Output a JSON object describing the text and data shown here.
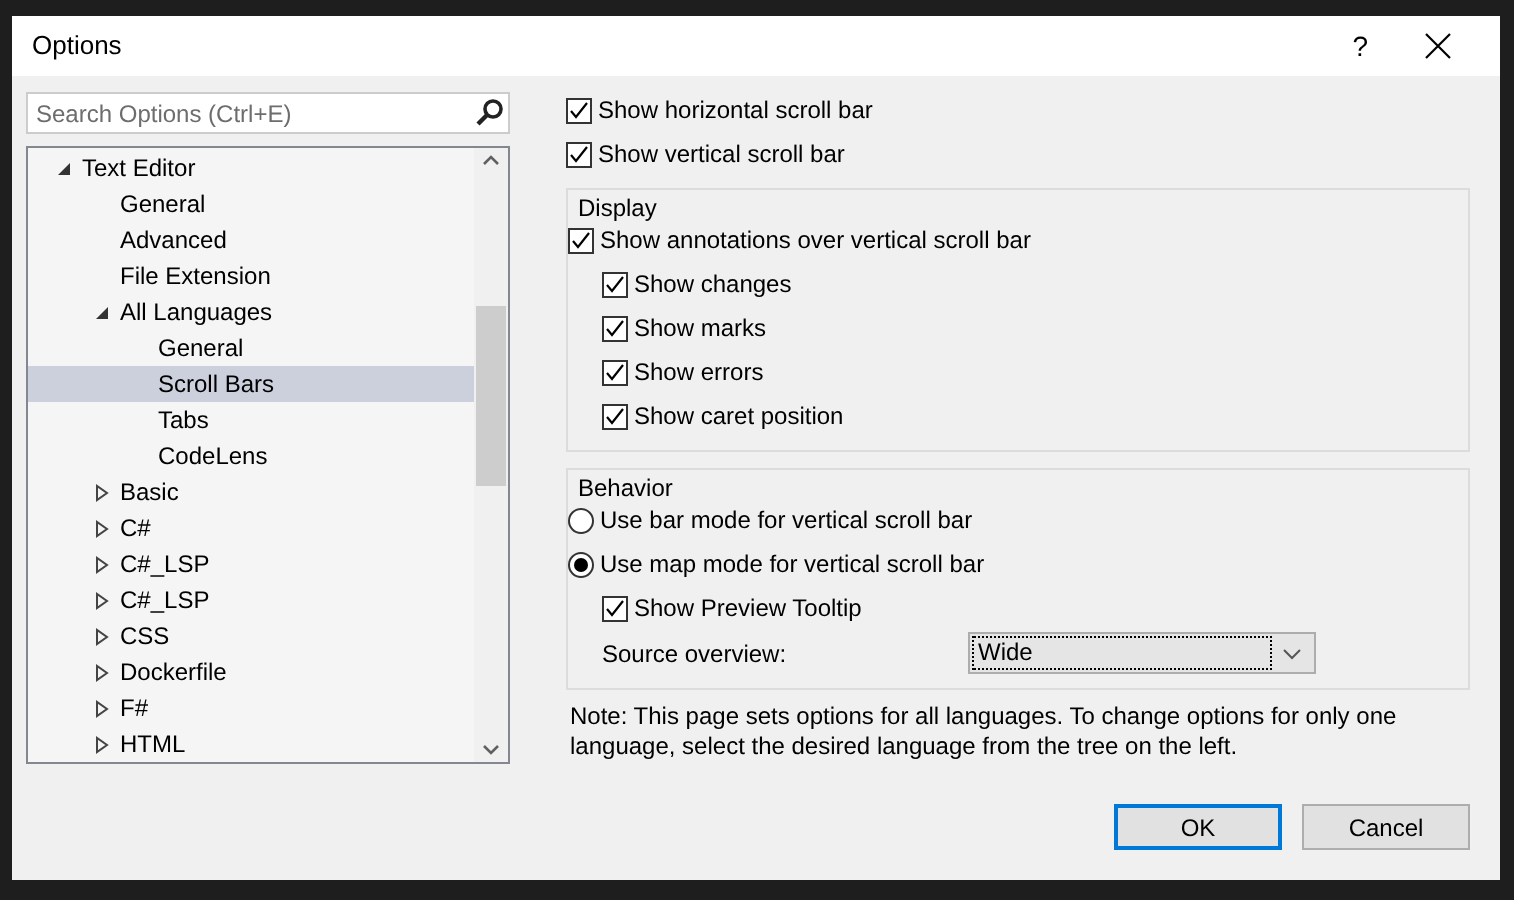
{
  "window": {
    "title": "Options",
    "help": "?"
  },
  "search": {
    "placeholder": "Search Options (Ctrl+E)"
  },
  "tree": {
    "items": [
      {
        "label": "Text Editor",
        "kind": "folder",
        "expanded": true,
        "selected": false,
        "children": [
          {
            "label": "General",
            "selected": false
          },
          {
            "label": "Advanced",
            "selected": false
          },
          {
            "label": "File Extension",
            "selected": false
          },
          {
            "label": "All Languages",
            "kind": "folder",
            "expanded": true,
            "selected": false,
            "children": [
              {
                "label": "General",
                "selected": false
              },
              {
                "label": "Scroll Bars",
                "selected": true
              },
              {
                "label": "Tabs",
                "selected": false
              },
              {
                "label": "CodeLens",
                "selected": false
              }
            ]
          },
          {
            "label": "Basic",
            "kind": "folder",
            "expanded": false,
            "selected": false
          },
          {
            "label": "C#",
            "kind": "folder",
            "expanded": false,
            "selected": false
          },
          {
            "label": "C#_LSP",
            "kind": "folder",
            "expanded": false,
            "selected": false
          },
          {
            "label": "C#_LSP",
            "kind": "folder",
            "expanded": false,
            "selected": false
          },
          {
            "label": "CSS",
            "kind": "folder",
            "expanded": false,
            "selected": false
          },
          {
            "label": "Dockerfile",
            "kind": "folder",
            "expanded": false,
            "selected": false
          },
          {
            "label": "F#",
            "kind": "folder",
            "expanded": false,
            "selected": false
          },
          {
            "label": "HTML",
            "kind": "folder",
            "expanded": false,
            "selected": false
          }
        ]
      }
    ]
  },
  "options": [
    {
      "kind": "checkbox",
      "label": "Show horizontal scroll bar",
      "checked": true
    },
    {
      "kind": "checkbox",
      "label": "Show vertical scroll bar",
      "checked": true
    }
  ],
  "groups": [
    {
      "title": "Display",
      "items": [
        {
          "kind": "checkbox",
          "label": "Show annotations over vertical scroll bar",
          "checked": true,
          "children": [
            {
              "kind": "checkbox",
              "label": "Show changes",
              "checked": true
            },
            {
              "kind": "checkbox",
              "label": "Show marks",
              "checked": true
            },
            {
              "kind": "checkbox",
              "label": "Show errors",
              "checked": true
            },
            {
              "kind": "checkbox",
              "label": "Show caret position",
              "checked": true
            }
          ]
        }
      ]
    },
    {
      "title": "Behavior",
      "items": [
        {
          "kind": "radio",
          "label": "Use bar mode for vertical scroll bar",
          "selected": false
        },
        {
          "kind": "radio",
          "label": "Use map mode for vertical scroll bar",
          "selected": true,
          "children": [
            {
              "kind": "checkbox",
              "label": "Show Preview Tooltip",
              "checked": true
            },
            {
              "kind": "select",
              "label": "Source overview:",
              "value": "Wide"
            }
          ]
        }
      ]
    }
  ],
  "note": "Note: This page sets options for all languages. To change options for only one language, select the desired language from the tree on the left.",
  "buttons": [
    {
      "label": "OK",
      "default": true
    },
    {
      "label": "Cancel",
      "default": false
    }
  ]
}
